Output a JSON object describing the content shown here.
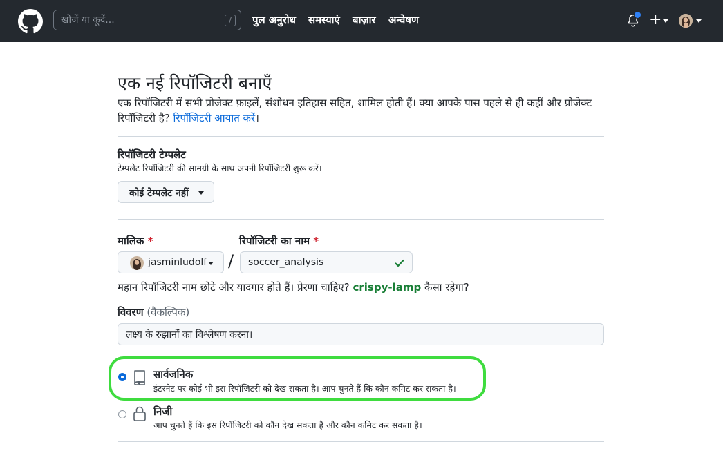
{
  "header": {
    "search_placeholder": "खोजें या कूदें...",
    "search_shortcut": "/",
    "nav": [
      "पुल अनुरोध",
      "समस्याएं",
      "बाज़ार",
      "अन्वेषण"
    ],
    "plus": "+"
  },
  "page": {
    "title": "एक नई रिपॉजिटरी बनाएँ",
    "intro_text": "एक रिपॉजिटरी में सभी प्रोजेक्ट फ़ाइलें, संशोधन इतिहास सहित, शामिल होती हैं। क्या आपके पास पहले से ही कहीं और प्रोजेक्ट रिपॉजिटरी है?",
    "import_link": "रिपॉजिटरी आयात करें",
    "intro_end": "।"
  },
  "template": {
    "label": "रिपॉजिटरी टेम्पलेट",
    "help": "टेम्पलेट रिपॉजिटरी की सामग्री के साथ अपनी रिपॉजिटरी शुरू करें।",
    "button": "कोई टेम्पलेट नहीं"
  },
  "owner": {
    "label": "मालिक",
    "required_mark": "*",
    "value": "jasminludolf"
  },
  "separator": "/",
  "repo_name": {
    "label": "रिपॉजिटरी का नाम",
    "required_mark": "*",
    "value": "soccer_analysis"
  },
  "suggestion": {
    "before": "महान रिपॉजिटरी नाम छोटे और यादगार होते हैं। प्रेरणा चाहिए?",
    "name": "crispy-lamp",
    "after": "कैसा रहेगा?"
  },
  "description": {
    "label": "विवरण",
    "optional": "(वैकल्पिक)",
    "value": "लक्ष्य के रुझानों का विश्लेषण करना।"
  },
  "visibility": [
    {
      "title": "सार्वजनिक",
      "desc": "इंटरनेट पर कोई भी इस रिपॉजिटरी को देख सकता है। आप चुनते हैं कि कौन कमिट कर सकता है।",
      "selected": true
    },
    {
      "title": "निजी",
      "desc": "आप चुनते हैं कि इस रिपॉजिटरी को कौन देख सकता है और कौन कमिट कर सकता है।",
      "selected": false
    }
  ],
  "colors": {
    "header_bg": "#24292f",
    "link": "#0969da",
    "success": "#1a7f37",
    "highlight": "#3fdc3f",
    "required": "#cf222e"
  }
}
